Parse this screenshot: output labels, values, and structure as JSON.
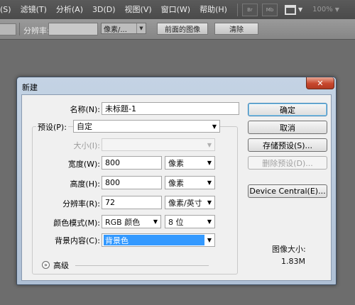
{
  "menubar": {
    "items": [
      "(S)",
      "滤镜(T)",
      "分析(A)",
      "3D(D)",
      "视图(V)",
      "窗口(W)",
      "帮助(H)"
    ],
    "btn_br": "Br",
    "btn_mb": "Mb",
    "zoom": "100%"
  },
  "optionsbar": {
    "resolution_label": "分辨率:",
    "resolution_value": "",
    "unit": "像素/...",
    "front_image_button": "前面的图像",
    "clear_button": "清除"
  },
  "dialog": {
    "title": "新建",
    "close_glyph": "✕",
    "name": {
      "label": "名称(N):",
      "value": "未标题-1"
    },
    "preset": {
      "label": "预设(P):",
      "value": "自定"
    },
    "size": {
      "label": "大小(I):",
      "value": ""
    },
    "width": {
      "label": "宽度(W):",
      "value": "800",
      "unit": "像素"
    },
    "height": {
      "label": "高度(H):",
      "value": "800",
      "unit": "像素"
    },
    "resolution": {
      "label": "分辨率(R):",
      "value": "72",
      "unit": "像素/英寸"
    },
    "color_mode": {
      "label": "颜色模式(M):",
      "value": "RGB 颜色",
      "depth": "8 位"
    },
    "background": {
      "label": "背景内容(C):",
      "value": "背景色"
    },
    "advanced": {
      "label": "高级",
      "icon_glyph": "»"
    },
    "buttons": {
      "ok": "确定",
      "cancel": "取消",
      "save_preset": "存储预设(S)...",
      "delete_preset": "删除预设(D)...",
      "device_central": "Device Central(E)..."
    },
    "image_size": {
      "label": "图像大小:",
      "value": "1.83M"
    }
  }
}
